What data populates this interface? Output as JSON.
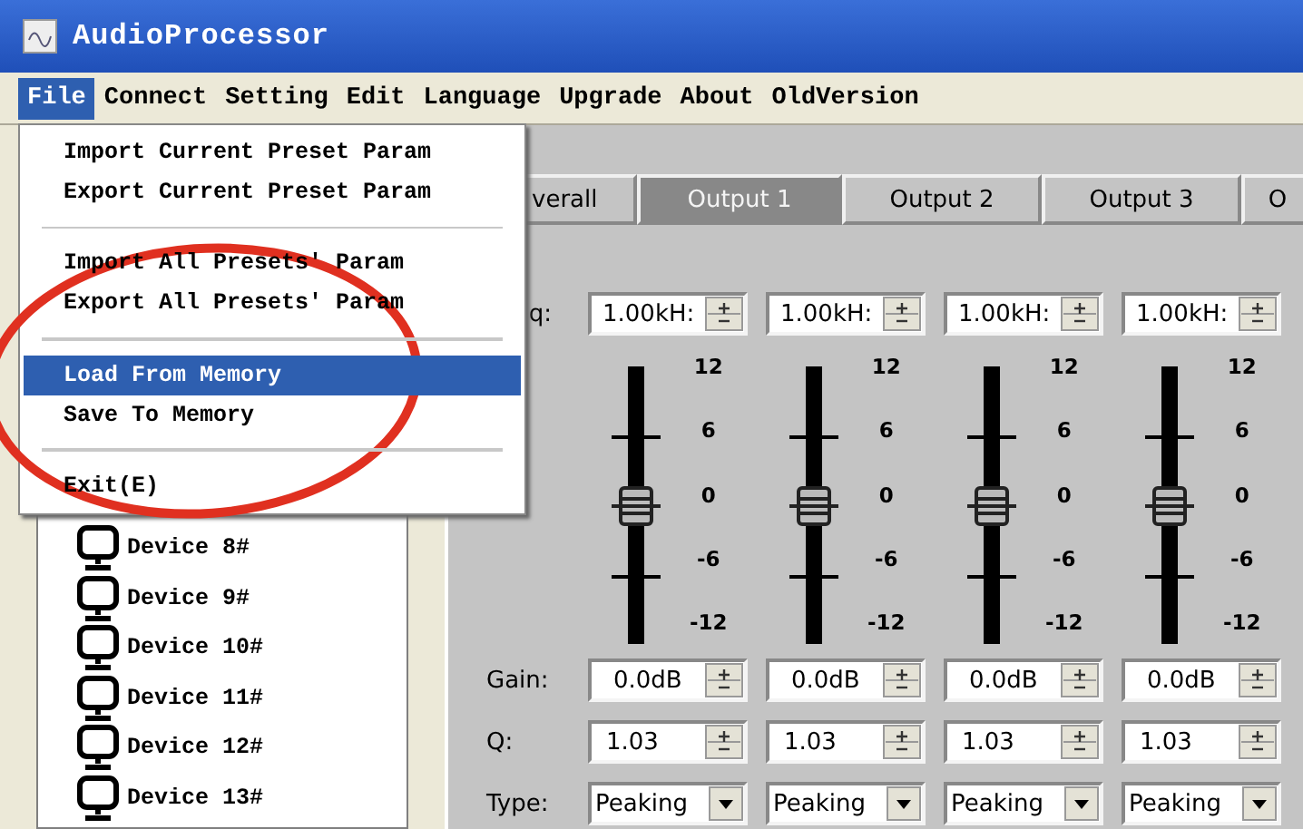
{
  "window": {
    "title": "AudioProcessor"
  },
  "menu_bar": [
    {
      "label": "File",
      "selected": true
    },
    {
      "label": "Connect",
      "selected": false
    },
    {
      "label": "Setting",
      "selected": false
    },
    {
      "label": "Edit",
      "selected": false
    },
    {
      "label": "Language",
      "selected": false
    },
    {
      "label": "Upgrade",
      "selected": false
    },
    {
      "label": "About",
      "selected": false
    },
    {
      "label": "OldVersion",
      "selected": false
    }
  ],
  "file_menu": [
    {
      "kind": "item",
      "label": "Import Current Preset Param",
      "selected": false
    },
    {
      "kind": "item",
      "label": "Export Current Preset Param",
      "selected": false
    },
    {
      "kind": "separator"
    },
    {
      "kind": "item",
      "label": "Import All Presets' Param",
      "selected": false
    },
    {
      "kind": "item",
      "label": "Export All Presets' Param",
      "selected": false
    },
    {
      "kind": "separator"
    },
    {
      "kind": "item",
      "label": "Load From Memory",
      "selected": true
    },
    {
      "kind": "item",
      "label": "Save To Memory",
      "selected": false
    },
    {
      "kind": "separator"
    },
    {
      "kind": "item",
      "label": "Exit(E)",
      "selected": false
    }
  ],
  "device_tree": [
    {
      "label": "Device 8#"
    },
    {
      "label": "Device 9#"
    },
    {
      "label": "Device 10#"
    },
    {
      "label": "Device 11#"
    },
    {
      "label": "Device 12#"
    },
    {
      "label": "Device 13#"
    }
  ],
  "tabs": [
    {
      "label": "verall",
      "selected": false
    },
    {
      "label": "Output 1",
      "selected": true
    },
    {
      "label": "Output 2",
      "selected": false
    },
    {
      "label": "Output 3",
      "selected": false
    },
    {
      "label": "O",
      "selected": false
    }
  ],
  "eq": {
    "labels": {
      "freq": "q:",
      "gain": "Gain:",
      "q": "Q:",
      "type": "Type:"
    },
    "bands": [
      {
        "freq": "1.00kH:",
        "level": 0.5,
        "scale": [
          "12",
          "6",
          "0",
          "-6",
          "-12"
        ],
        "gain": "0.0dB",
        "q": "1.03",
        "type": "Peaking"
      },
      {
        "freq": "1.00kH:",
        "level": 0.5,
        "scale": [
          "12",
          "6",
          "0",
          "-6",
          "-12"
        ],
        "gain": "0.0dB",
        "q": "1.03",
        "type": "Peaking"
      },
      {
        "freq": "1.00kH:",
        "level": 0.5,
        "scale": [
          "12",
          "6",
          "0",
          "-6",
          "-12"
        ],
        "gain": "0.0dB",
        "q": "1.03",
        "type": "Peaking"
      },
      {
        "freq": "1.00kH:",
        "level": 0.5,
        "scale": [
          "12",
          "6",
          "0",
          "-6",
          "-12"
        ],
        "gain": "0.0dB",
        "q": "1.03",
        "type": "Peaking"
      }
    ]
  }
}
